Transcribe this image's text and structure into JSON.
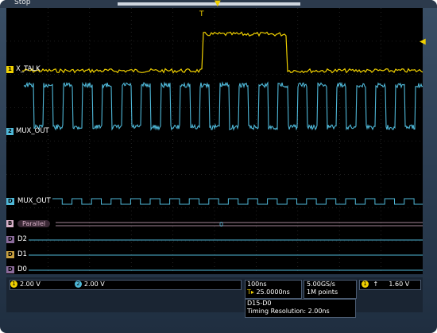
{
  "top_bar": {
    "run_state": "Stop"
  },
  "channels": [
    {
      "id": "1",
      "label": "X_TALK",
      "color": "#f0d000"
    },
    {
      "id": "2",
      "label": "MUX_OUT",
      "color": "#4fb8d8"
    }
  ],
  "digital": [
    {
      "id": "D1",
      "label": "MUX_OUT"
    },
    {
      "id": "D2",
      "label": "D2"
    },
    {
      "id": "D1b",
      "label": "D1"
    },
    {
      "id": "D0",
      "label": "D0"
    }
  ],
  "bus": {
    "label": "Parallel",
    "marker": "B",
    "value": "0"
  },
  "status": {
    "ch1_scale": "2.00 V",
    "ch2_scale": "2.00 V",
    "time_per_div": "100ns",
    "trigger_delay": "25.0000ns",
    "sample_rate": "5.00GS/s",
    "record_length": "1M points",
    "trigger_source": "1",
    "trigger_slope": "↑",
    "trigger_level": "1.60 V",
    "bus_channels": "D15-D0",
    "timing_resolution": "Timing Resolution: 2.00ns"
  },
  "trigger_marker": "T",
  "colors": {
    "ch1": "#f0d000",
    "ch2": "#4fb8d8",
    "digital": "#4fb8d8",
    "bus": "#d8b0c8"
  }
}
